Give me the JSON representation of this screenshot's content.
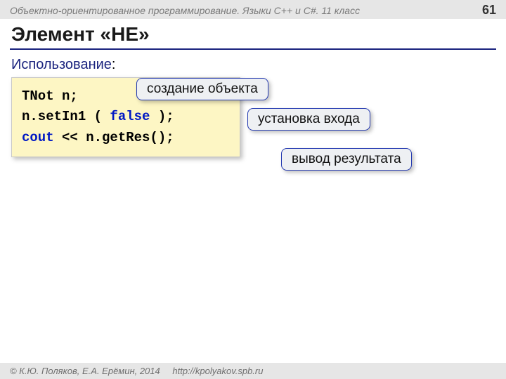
{
  "header": {
    "course": "Объектно-ориентированное программирование. Языки C++ и C#. 11 класс",
    "page": "61"
  },
  "title": "Элемент «НЕ»",
  "section_label": "Использование",
  "section_colon": ":",
  "code": {
    "l1a": "TNot n;",
    "l2a": "n.setIn1 ( ",
    "l2k": "false",
    "l2b": " );",
    "l3k": "cout",
    "l3a": " << n.getRes();"
  },
  "callouts": {
    "c1": "создание объекта",
    "c2": "установка входа",
    "c3": "вывод результата"
  },
  "footer": {
    "copy": "© К.Ю. Поляков, Е.А. Ерёмин, 2014",
    "url": "http://kpolyakov.spb.ru"
  }
}
